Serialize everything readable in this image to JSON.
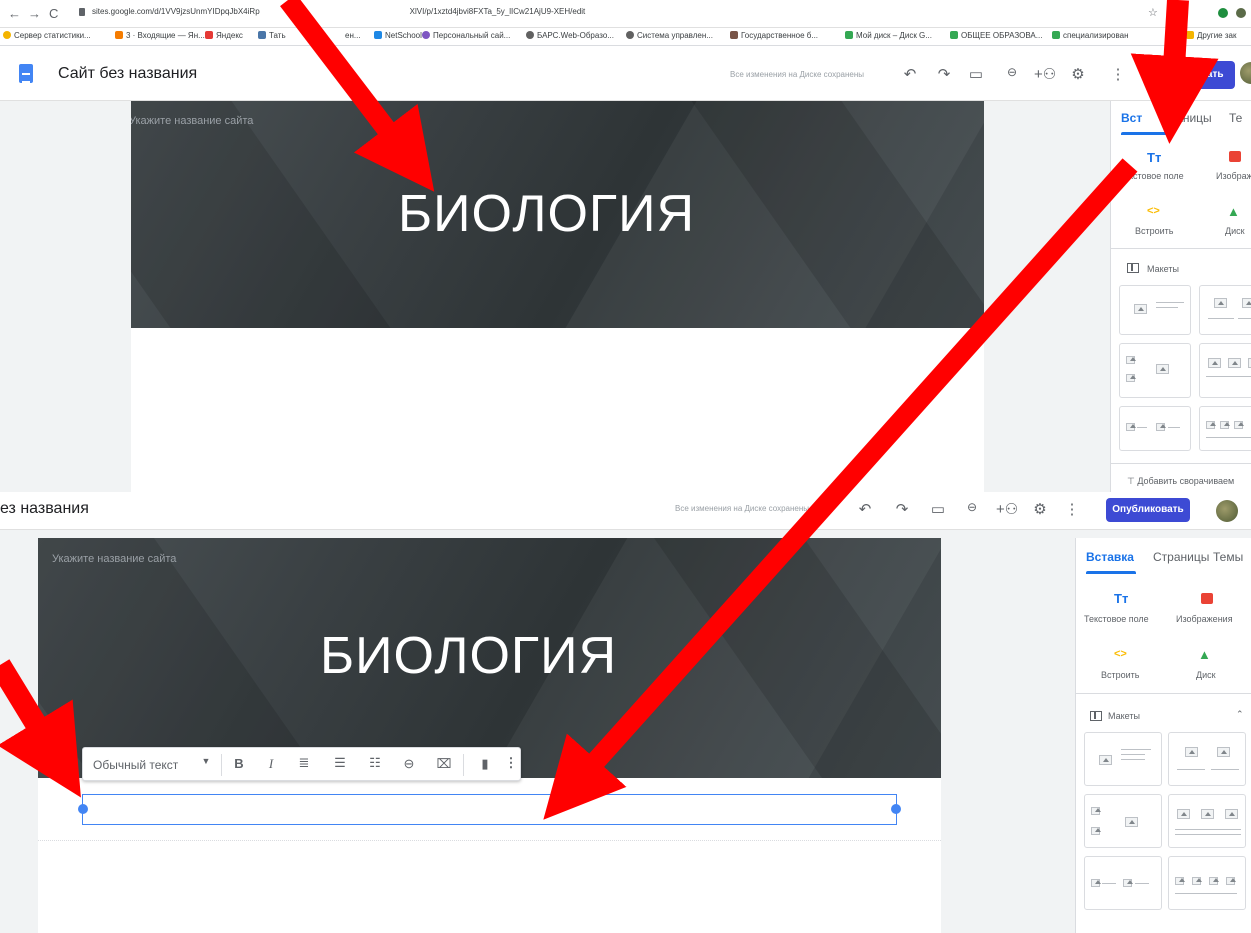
{
  "browser": {
    "url": "sites.google.com/d/1VV9jzsUnmYIDpqJbX4iRp",
    "url_tail": "XlVI/p/1xztd4jbvi8FXTa_5y_lICw21AjU9-XEH/edit",
    "bookmarks": [
      "Сервер статистики...",
      "3 · Входящие — Ян...",
      "Яндекс",
      "Тать",
      "ен...",
      "NetSchool",
      "Персональный сай...",
      "БАРС.Web-Образо...",
      "Система управлен...",
      "Государственное б...",
      "Мой диск – Диск G...",
      "ОБЩЕЕ ОБРАЗОВА...",
      "специализирован"
    ],
    "more_bookmarks": "»",
    "other_bookmarks": "Другие зак"
  },
  "colors": {
    "accent": "#1a73e8",
    "publish": "#3d4ad4",
    "banner": "#363d40",
    "arrow": "#ff0000",
    "image_icon": "#ea4335",
    "embed_icon": "#fbbc04"
  },
  "top": {
    "site_title": "Сайт без названия",
    "saved_status": "Все изменения на Диске сохранены",
    "publish_label": "бликовать",
    "site_name_placeholder": "Укажите название сайта",
    "hero_text": "БИОЛОГИЯ",
    "tabs": [
      "Вст",
      "траницы",
      "Те"
    ],
    "insert_items": [
      "Текстовое поле",
      "Изображен",
      "Встроить",
      "Диск"
    ],
    "insert_text_icon": "Tт",
    "layouts_label": "Макеты",
    "add_collapsible": "Добавить сворачиваем"
  },
  "bottom": {
    "site_title_partial": "ез названия",
    "saved_status": "Все изменения на Диске сохранены",
    "publish_label": "Опубликовать",
    "site_name_placeholder": "Укажите название сайта",
    "hero_text": "БИОЛОГИЯ",
    "tabs": [
      "Вставка",
      "Страницы",
      "Темы"
    ],
    "insert_items": [
      "Текстовое поле",
      "Изображения",
      "Встроить",
      "Диск"
    ],
    "insert_text_icon": "Tт",
    "layouts_label": "Макеты",
    "text_style": "Обычный текст",
    "icons": [
      "bold-icon",
      "italic-icon",
      "align-left-icon",
      "numbered-list-icon",
      "bulleted-list-icon",
      "link-icon",
      "clear-format-icon",
      "delete-icon",
      "more-icon"
    ]
  }
}
